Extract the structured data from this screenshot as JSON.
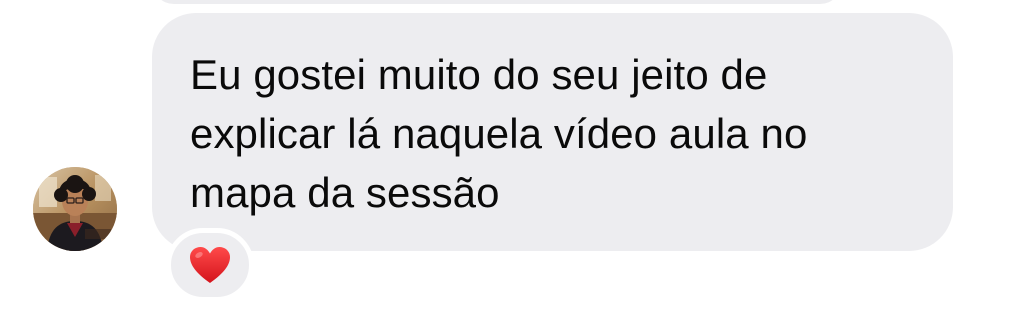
{
  "message": {
    "text": "Eu gostei muito do seu jeito de\nexplicar lá naquela vídeo aula  no\nmapa da sessão",
    "bubble_color": "#ededf0",
    "text_color": "#0a0a0a"
  },
  "sender": {
    "avatar_icon": "person-avatar"
  },
  "reaction": {
    "icon": "red-heart-icon",
    "color": "#e8202a"
  }
}
